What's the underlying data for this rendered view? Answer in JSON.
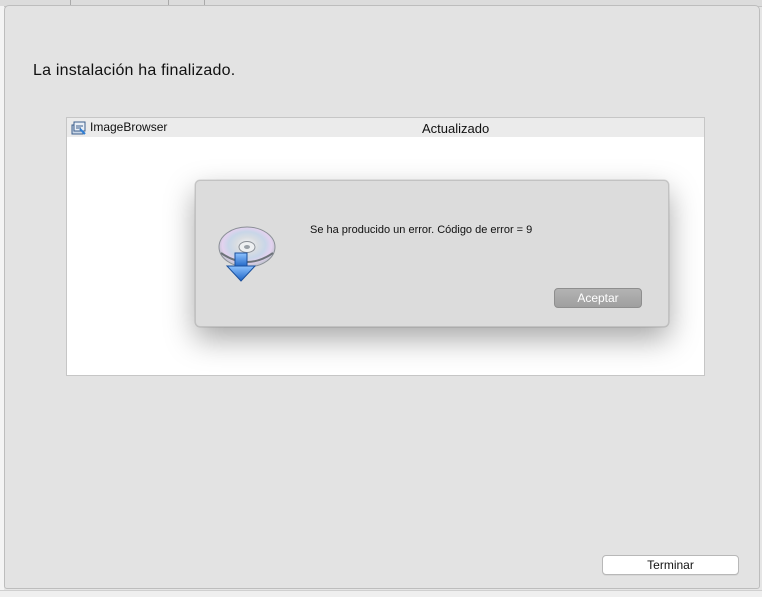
{
  "window": {
    "title": "La instalación ha finalizado."
  },
  "install_list": {
    "rows": [
      {
        "name": "ImageBrowser",
        "status": "Actualizado",
        "icon": "installer-icon"
      }
    ]
  },
  "error_dialog": {
    "icon": "disc-install-icon",
    "message": "Se ha producido un error. Código de error = 9",
    "ok_label": "Aceptar"
  },
  "footer": {
    "finish_label": "Terminar"
  },
  "colors": {
    "window_bg": "#e3e3e3",
    "dialog_bg": "#dcdcdc",
    "list_header_bg": "#ebebeb",
    "disc_arrow_blue": "#2f7fd6"
  }
}
